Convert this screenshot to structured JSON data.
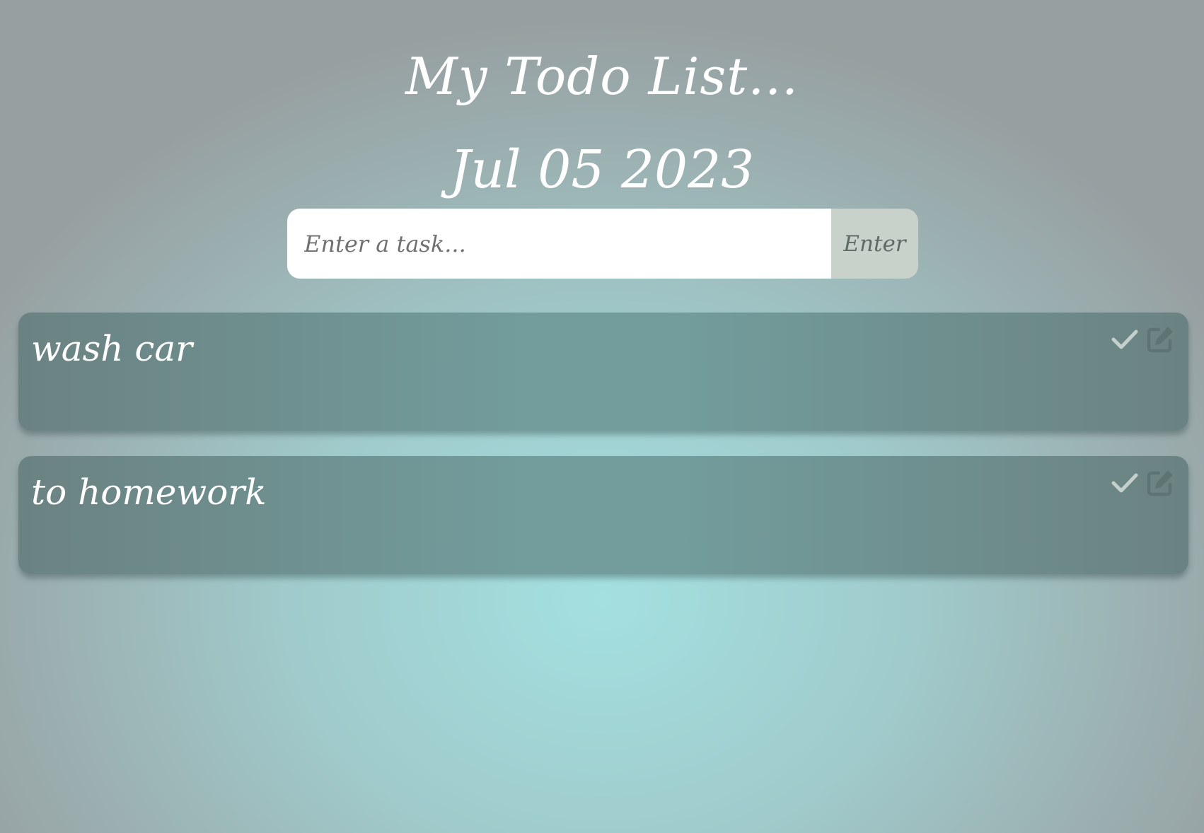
{
  "header": {
    "title": "My Todo List...",
    "date": "Jul 05 2023"
  },
  "task_input": {
    "placeholder": "Enter a task...",
    "value": "",
    "button_label": "Enter"
  },
  "tasks": [
    {
      "text": "wash car",
      "actions": [
        "check-icon",
        "edit-icon"
      ]
    },
    {
      "text": "to homework",
      "actions": [
        "check-icon",
        "edit-icon"
      ]
    }
  ],
  "colors": {
    "title_text": "#ffffff",
    "card_background": "#729595",
    "enter_button_bg": "#c9d1cb",
    "check_icon": "#c4d0cb",
    "edit_icon": "#5e7473"
  }
}
